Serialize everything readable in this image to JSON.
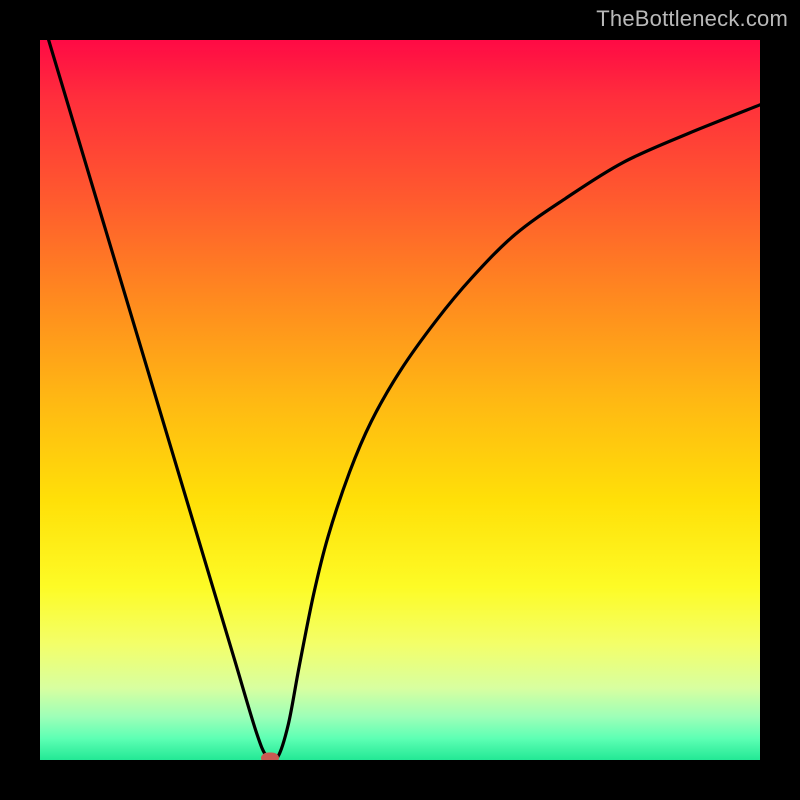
{
  "watermark": "TheBottleneck.com",
  "colors": {
    "frame": "#000000",
    "curve": "#000000",
    "marker": "#c85a52",
    "gradient_top": "#ff0a45",
    "gradient_bottom": "#23e895"
  },
  "chart_data": {
    "type": "line",
    "title": "",
    "xlabel": "",
    "ylabel": "",
    "xlim": [
      0,
      100
    ],
    "ylim": [
      0,
      100
    ],
    "grid": false,
    "legend": false,
    "series": [
      {
        "name": "bottleneck-curve",
        "x": [
          0,
          3,
          6,
          9,
          12,
          15,
          18,
          21,
          24,
          27,
          30,
          31.5,
          33,
          34.5,
          36,
          38,
          40,
          43,
          46,
          50,
          55,
          60,
          66,
          73,
          81,
          90,
          100
        ],
        "y": [
          104,
          94,
          84,
          74,
          64,
          54,
          44,
          34,
          24,
          14,
          4,
          0.5,
          0.4,
          5,
          13,
          23,
          31,
          40,
          47,
          54,
          61,
          67,
          73,
          78,
          83,
          87,
          91
        ]
      }
    ],
    "marker": {
      "x": 32,
      "y": 0
    },
    "background_gradient": {
      "direction": "vertical",
      "stops": [
        {
          "pos": 0.0,
          "color": "#ff0a45"
        },
        {
          "pos": 0.08,
          "color": "#ff2e3c"
        },
        {
          "pos": 0.22,
          "color": "#ff5a2e"
        },
        {
          "pos": 0.36,
          "color": "#ff8a1f"
        },
        {
          "pos": 0.5,
          "color": "#ffb813"
        },
        {
          "pos": 0.64,
          "color": "#ffe008"
        },
        {
          "pos": 0.76,
          "color": "#fdfb26"
        },
        {
          "pos": 0.84,
          "color": "#f3ff6a"
        },
        {
          "pos": 0.9,
          "color": "#d8ffa0"
        },
        {
          "pos": 0.94,
          "color": "#9dffb8"
        },
        {
          "pos": 0.97,
          "color": "#5dffb4"
        },
        {
          "pos": 1.0,
          "color": "#23e895"
        }
      ]
    }
  }
}
